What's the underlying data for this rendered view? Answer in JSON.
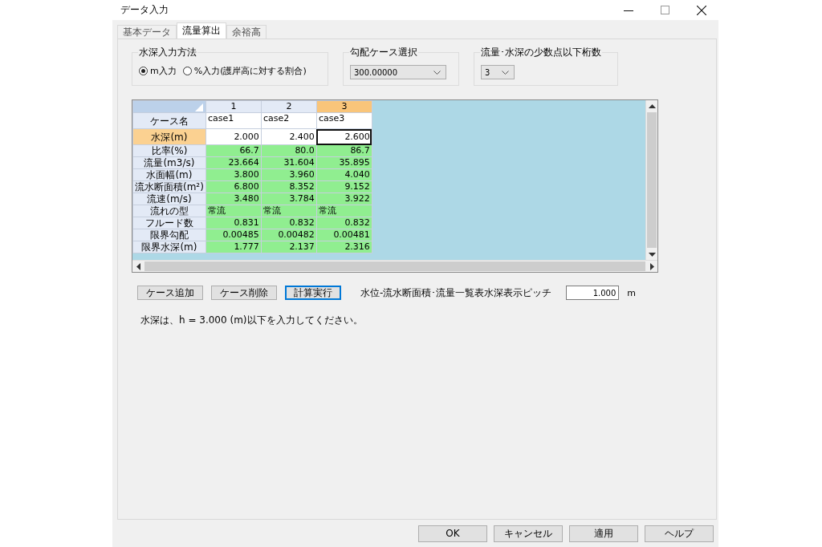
{
  "window": {
    "title": "データ入力"
  },
  "tabs": [
    {
      "label": "基本データ",
      "selected": false
    },
    {
      "label": "流量算出",
      "selected": true
    },
    {
      "label": "余裕高",
      "selected": false
    }
  ],
  "depth_input_method": {
    "title": "水深入力方法",
    "options": [
      {
        "label": "m入力",
        "selected": true
      },
      {
        "label": "%入力(護岸高に対する割合)",
        "selected": false
      }
    ]
  },
  "slope_case": {
    "title": "勾配ケース選択",
    "value": "300.00000"
  },
  "decimal_digits": {
    "title": "流量･水深の少数点以下桁数",
    "value": "3"
  },
  "grid": {
    "columns": [
      {
        "label": "1",
        "selected": false
      },
      {
        "label": "2",
        "selected": false
      },
      {
        "label": "3",
        "selected": true
      }
    ],
    "rows": [
      {
        "header": "ケース名",
        "kind": "name",
        "selected": false,
        "cells": [
          "case1",
          "case2",
          "case3"
        ]
      },
      {
        "header": "水深(m)",
        "kind": "input",
        "selected": true,
        "cells": [
          "2.000",
          "2.400",
          "2.600"
        ]
      },
      {
        "header": "比率(%)",
        "kind": "result",
        "selected": false,
        "cells": [
          "66.7",
          "80.0",
          "86.7"
        ]
      },
      {
        "header": "流量(m3/s)",
        "kind": "result",
        "selected": false,
        "cells": [
          "23.664",
          "31.604",
          "35.895"
        ]
      },
      {
        "header": "水面幅(m)",
        "kind": "result",
        "selected": false,
        "cells": [
          "3.800",
          "3.960",
          "4.040"
        ]
      },
      {
        "header": "流水断面積(m²)",
        "kind": "result",
        "selected": false,
        "cells": [
          "6.800",
          "8.352",
          "9.152"
        ]
      },
      {
        "header": "流速(m/s)",
        "kind": "result",
        "selected": false,
        "cells": [
          "3.480",
          "3.784",
          "3.922"
        ]
      },
      {
        "header": "流れの型",
        "kind": "result_text",
        "selected": false,
        "cells": [
          "常流",
          "常流",
          "常流"
        ]
      },
      {
        "header": "フルード数",
        "kind": "result",
        "selected": false,
        "cells": [
          "0.831",
          "0.832",
          "0.832"
        ]
      },
      {
        "header": "限界勾配",
        "kind": "result",
        "selected": false,
        "cells": [
          "0.00485",
          "0.00482",
          "0.00481"
        ]
      },
      {
        "header": "限界水深(m)",
        "kind": "result",
        "selected": false,
        "cells": [
          "1.777",
          "2.137",
          "2.316"
        ]
      }
    ]
  },
  "actions": [
    {
      "label": "ケース追加",
      "default": false
    },
    {
      "label": "ケース削除",
      "default": false
    },
    {
      "label": "計算実行",
      "default": true
    }
  ],
  "pitch": {
    "label": "水位-流水断面積･流量一覧表水深表示ピッチ",
    "value": "1.000",
    "unit": "m"
  },
  "note": "水深は、h = 3.000 (m)以下を入力してください。",
  "footer_buttons": [
    "OK",
    "キャンセル",
    "適用",
    "ヘルプ"
  ]
}
